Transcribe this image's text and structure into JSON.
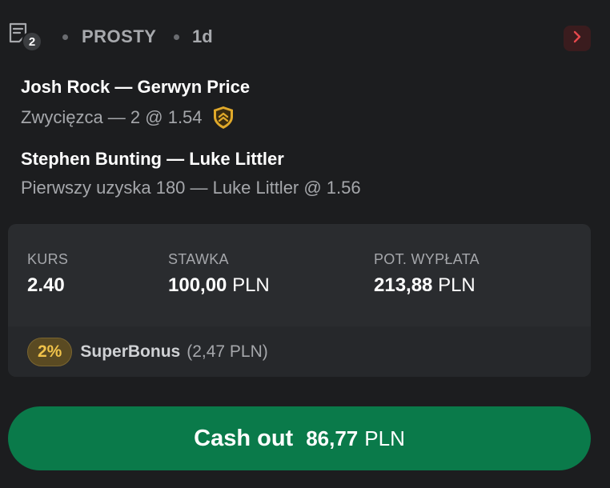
{
  "header": {
    "icon": "bet-slip-icon",
    "count": "2",
    "type": "PROSTY",
    "age": "1d",
    "expand_icon": "chevron-right-icon",
    "expand_color": "#e5484d"
  },
  "selections": [
    {
      "title": "Josh Rock — Gerwyn Price",
      "market": "Zwycięzca — 2 @ 1.54",
      "boost_icon": "boost-shield-icon"
    },
    {
      "title": "Stephen Bunting — Luke Littler",
      "market": "Pierwszy uzyska 180 — Luke Littler @ 1.56"
    }
  ],
  "stats": {
    "odds": {
      "label": "KURS",
      "value": "2.40"
    },
    "stake": {
      "label": "STAWKA",
      "value": "100,00",
      "currency": "PLN"
    },
    "payout": {
      "label": "POT. WYPŁATA",
      "value": "213,88",
      "currency": "PLN"
    }
  },
  "bonus": {
    "percent": "2%",
    "name": "SuperBonus",
    "amount": "(2,47 PLN)",
    "color": "#f0c24a"
  },
  "cashout": {
    "label": "Cash out",
    "amount": "86,77",
    "currency": "PLN",
    "color": "#0a7a4a"
  }
}
